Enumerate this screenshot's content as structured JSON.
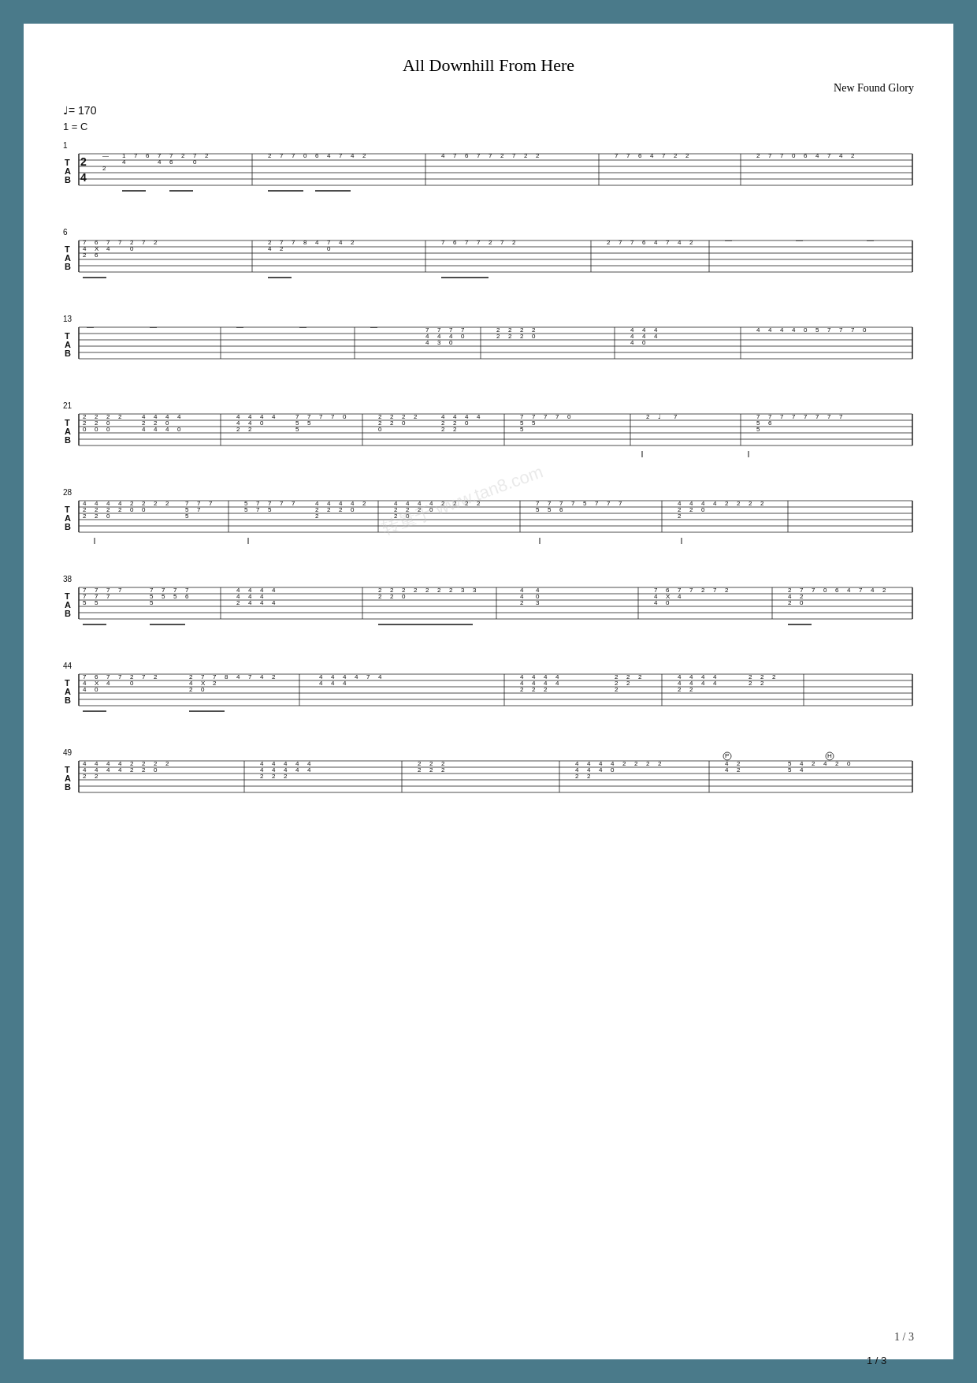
{
  "page": {
    "title": "All Downhill From Here",
    "artist": "New Found Glory",
    "tempo": "♩= 170",
    "key": "1 = C",
    "time_signature": "2/4",
    "page_indicator": "1 / 3"
  },
  "watermark": "转量于 www.tan8.com"
}
